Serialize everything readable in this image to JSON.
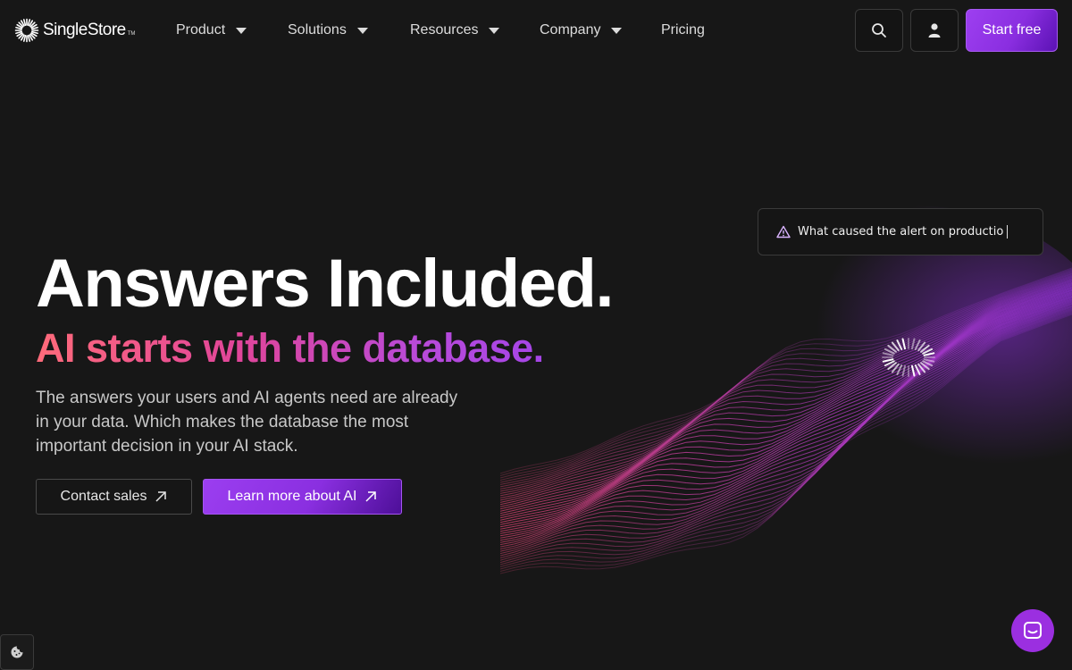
{
  "brand": {
    "name": "SingleStore",
    "trademark": "TM"
  },
  "nav": {
    "items": [
      {
        "label": "Product",
        "has_dropdown": true
      },
      {
        "label": "Solutions",
        "has_dropdown": true
      },
      {
        "label": "Resources",
        "has_dropdown": true
      },
      {
        "label": "Company",
        "has_dropdown": true
      },
      {
        "label": "Pricing",
        "has_dropdown": false
      }
    ],
    "search_icon": "search-icon",
    "account_icon": "user-icon",
    "cta_label": "Start free"
  },
  "hero": {
    "title": "Answers Included.",
    "subtitle": "AI starts with the database.",
    "description": "The answers your users and AI agents need are already in your data. Which makes the database the most important decision in your AI stack.",
    "secondary_button": "Contact sales",
    "primary_button": "Learn more about AI"
  },
  "prompt_card": {
    "icon": "warning-icon",
    "text": "What caused the alert on productio"
  },
  "widgets": {
    "cookie_icon": "cookie-icon",
    "chat_icon": "chat-icon"
  },
  "colors": {
    "background": "#171717",
    "accent": "#9b3ef0",
    "gradient_start": "#ff6b7a",
    "gradient_end": "#a545e8"
  }
}
